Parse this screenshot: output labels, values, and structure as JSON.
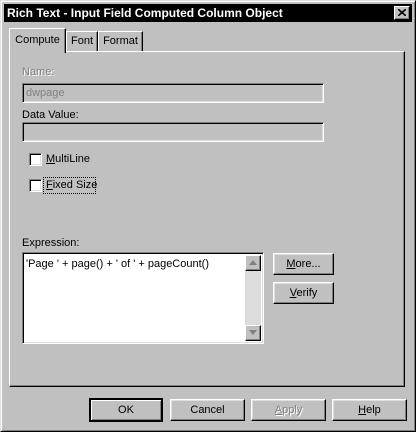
{
  "window": {
    "title": "Rich Text - Input Field Computed Column Object"
  },
  "tabs": [
    {
      "label": "Compute",
      "active": true
    },
    {
      "label": "Font",
      "active": false
    },
    {
      "label": "Format",
      "active": false
    }
  ],
  "name_field": {
    "label": "Name:",
    "value": "dwpage"
  },
  "data_value_field": {
    "label": "Data Value:",
    "value": ""
  },
  "multiline": {
    "label_before": "",
    "label_underlined": "M",
    "label_after": "ultiLine",
    "checked": false
  },
  "fixed_size": {
    "label_before": "",
    "label_underlined": "F",
    "label_after": "ixed Size",
    "checked": false
  },
  "expression": {
    "label": "Expression:",
    "value": "'Page ' + page() + ' of ' + pageCount()"
  },
  "side_buttons": {
    "more_before": "",
    "more_u": "M",
    "more_after": "ore...",
    "verify_before": "",
    "verify_u": "V",
    "verify_after": "erify"
  },
  "footer": {
    "ok": "OK",
    "cancel": "Cancel",
    "apply_before": "",
    "apply_u": "A",
    "apply_after": "pply",
    "help_before": "",
    "help_u": "H",
    "help_after": "elp"
  }
}
